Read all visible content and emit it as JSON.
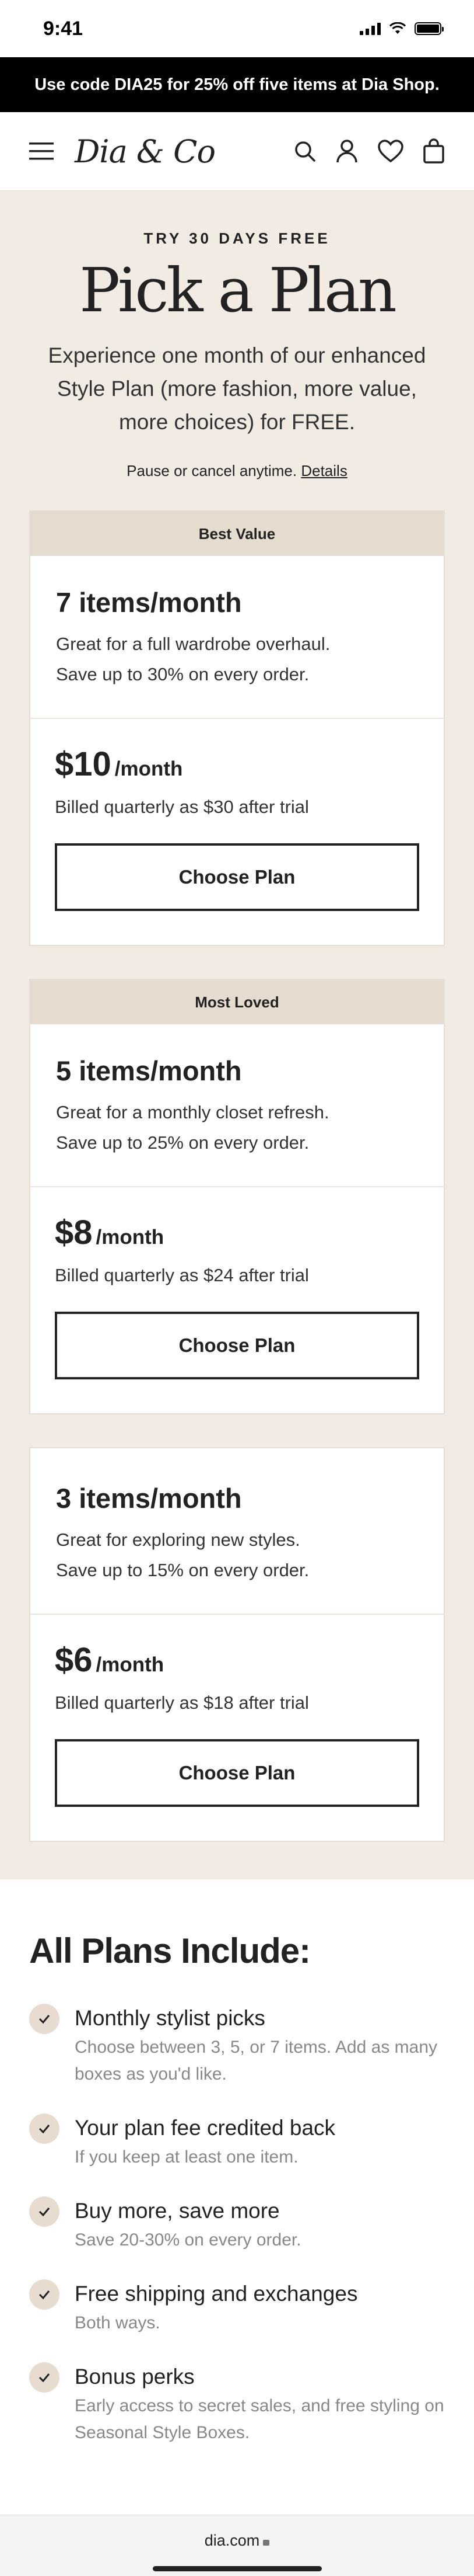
{
  "status": {
    "time": "9:41"
  },
  "promo": {
    "text": "Use code DIA25 for 25% off five items at Dia Shop."
  },
  "nav": {
    "logo": "Dia & Co"
  },
  "header": {
    "eyebrow": "TRY 30 DAYS FREE",
    "title": "Pick a Plan",
    "intro": "Experience one month of our enhanced Style Plan (more fashion, more value, more choices) for FREE.",
    "pause_text": "Pause or cancel anytime.",
    "details_link": "Details"
  },
  "plans": [
    {
      "tag": "Best Value",
      "items": "7 items/month",
      "desc_1": "Great for a full wardrobe overhaul.",
      "desc_2": "Save up to 30% on every order.",
      "price": "$10",
      "per": "/month",
      "billed": "Billed quarterly as $30 after trial",
      "cta": "Choose Plan"
    },
    {
      "tag": "Most Loved",
      "items": "5 items/month",
      "desc_1": "Great for a monthly closet refresh.",
      "desc_2": "Save up to 25% on every order.",
      "price": "$8",
      "per": "/month",
      "billed": "Billed quarterly as $24 after trial",
      "cta": "Choose Plan"
    },
    {
      "tag": "",
      "items": "3 items/month",
      "desc_1": "Great for exploring new styles.",
      "desc_2": "Save up to 15% on every order.",
      "price": "$6",
      "per": "/month",
      "billed": "Billed quarterly as $18 after trial",
      "cta": "Choose Plan"
    }
  ],
  "includes": {
    "title": "All Plans Include:",
    "items": [
      {
        "head": "Monthly stylist picks",
        "sub": "Choose between 3, 5, or 7 items. Add as many boxes as you'd like."
      },
      {
        "head": "Your plan fee credited back",
        "sub": "If you keep at least one item."
      },
      {
        "head": "Buy more, save more",
        "sub": "Save 20-30% on every order."
      },
      {
        "head": "Free shipping and exchanges",
        "sub": "Both ways."
      },
      {
        "head": "Bonus perks",
        "sub": "Early access to secret sales, and free styling on Seasonal Style Boxes."
      }
    ]
  },
  "browser": {
    "url": "dia.com"
  },
  "colors": {
    "accent_beige": "#e5dbcf",
    "section_bg": "#f1ebe4",
    "promo_bg": "#000000"
  },
  "icons": [
    "hamburger-icon",
    "search-icon",
    "account-icon",
    "heart-icon",
    "bag-icon",
    "check-icon",
    "lock-icon"
  ]
}
